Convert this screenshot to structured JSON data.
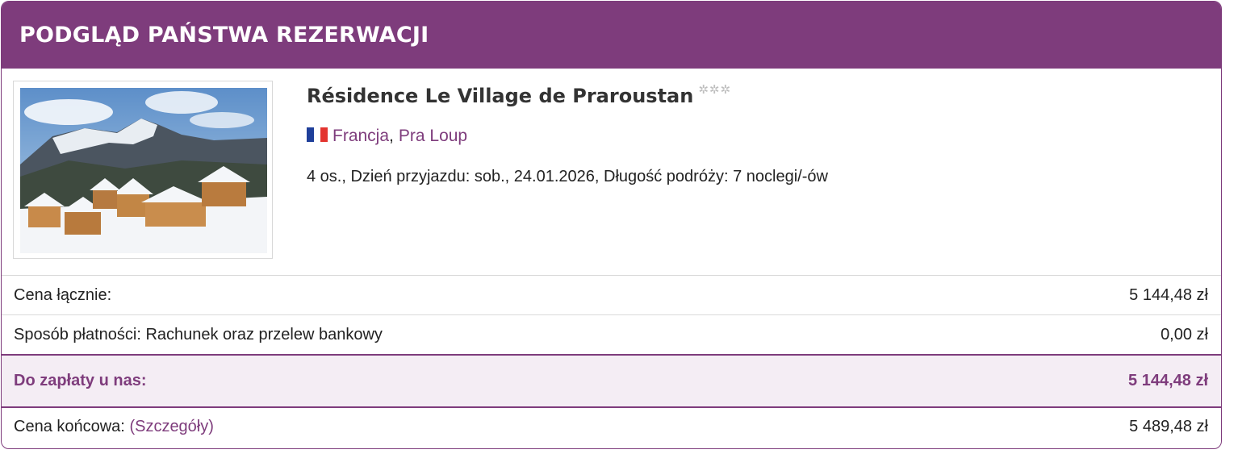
{
  "header": {
    "title": "PODGLĄD PAŃSTWA REZERWACJI"
  },
  "property": {
    "image_alt": "Snowy mountain chalets",
    "name": "Résidence Le Village de Praroustan",
    "stars": [
      "✲",
      "✲",
      "✲"
    ],
    "flag_icon": "france-flag-icon",
    "flag_colors": [
      "#1f3f9a",
      "#ffffff",
      "#e3342f"
    ],
    "country": "Francja",
    "separator": ",",
    "city": "Pra Loup",
    "details": "4 os., Dzień przyjazdu: sob., 24.01.2026, Długość podróży: 7 noclegi/-ów"
  },
  "prices": {
    "total_label": "Cena łącznie:",
    "total_value": "5 144,48 zł",
    "payment_label": "Sposób płatności: Rachunek oraz przelew bankowy",
    "payment_value": "0,00 zł",
    "due_label": "Do zapłaty u nas:",
    "due_value": "5 144,48 zł",
    "final_label": "Cena końcowa:",
    "final_link": "(Szczegóły)",
    "final_value": "5 489,48 zł"
  },
  "colors": {
    "accent": "#7e3c7c",
    "highlight_bg": "#f4edf4"
  }
}
